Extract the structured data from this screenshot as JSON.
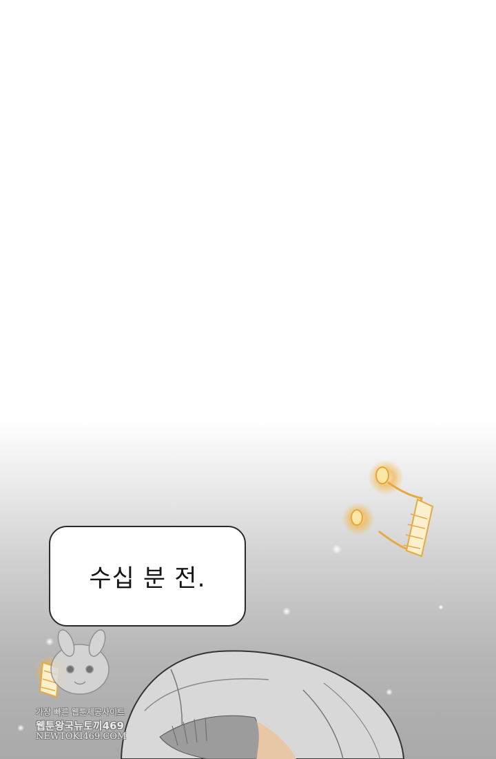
{
  "bubble": {
    "text": "수십 분 전."
  },
  "watermark": {
    "line1": "가장 빠른 웹툰제공사이트",
    "line2": "웹툰왕국뉴토끼469",
    "line3": "NEWTOKI469.COM"
  },
  "icons": {
    "music_note_large": "music-note-icon",
    "music_note_small": "music-note-icon"
  },
  "colors": {
    "glow": "#f2b64a",
    "bubble_border": "#2a2a2a",
    "hair": "#d8d8d8"
  }
}
